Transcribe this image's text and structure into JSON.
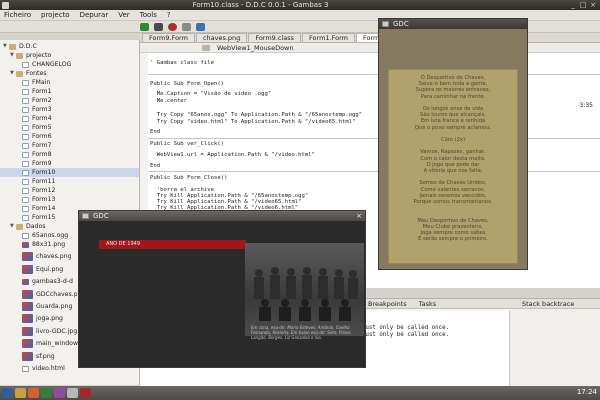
{
  "window": {
    "title": "Form10.class - D.D.C 0.0.1 - Gambas 3"
  },
  "menu": [
    "Ficheiro",
    "projecto",
    "Depurar",
    "Ver",
    "Tools",
    "?"
  ],
  "tree": [
    {
      "label": "D.D.C",
      "kind": "folder",
      "level": 0,
      "selected": false
    },
    {
      "label": "projecto",
      "kind": "folder",
      "level": 1,
      "selected": false
    },
    {
      "label": "CHANGELOG",
      "kind": "txt",
      "level": 2,
      "selected": false
    },
    {
      "label": "Fontes",
      "kind": "folder",
      "level": 1,
      "selected": false
    },
    {
      "label": "FMain",
      "kind": "form",
      "level": 2,
      "selected": false
    },
    {
      "label": "Form1",
      "kind": "form",
      "level": 2,
      "selected": false
    },
    {
      "label": "Form2",
      "kind": "form",
      "level": 2,
      "selected": false
    },
    {
      "label": "Form3",
      "kind": "form",
      "level": 2,
      "selected": false
    },
    {
      "label": "Form4",
      "kind": "form",
      "level": 2,
      "selected": false
    },
    {
      "label": "Form5",
      "kind": "form",
      "level": 2,
      "selected": false
    },
    {
      "label": "Form6",
      "kind": "form",
      "level": 2,
      "selected": false
    },
    {
      "label": "Form7",
      "kind": "form",
      "level": 2,
      "selected": false
    },
    {
      "label": "Form8",
      "kind": "form",
      "level": 2,
      "selected": false
    },
    {
      "label": "Form9",
      "kind": "form",
      "level": 2,
      "selected": false
    },
    {
      "label": "Form10",
      "kind": "form",
      "level": 2,
      "selected": true
    },
    {
      "label": "Form11",
      "kind": "form",
      "level": 2,
      "selected": false
    },
    {
      "label": "Form12",
      "kind": "form",
      "level": 2,
      "selected": false
    },
    {
      "label": "Form13",
      "kind": "form",
      "level": 2,
      "selected": false
    },
    {
      "label": "Form14",
      "kind": "form",
      "level": 2,
      "selected": false
    },
    {
      "label": "Form15",
      "kind": "form",
      "level": 2,
      "selected": false
    },
    {
      "label": "Dados",
      "kind": "folder",
      "level": 1,
      "selected": false
    },
    {
      "label": "65anos.ogg",
      "kind": "txt",
      "level": 2,
      "selected": false
    },
    {
      "label": "88x31.png",
      "kind": "img",
      "level": 2,
      "selected": false
    },
    {
      "label": "chaves.png",
      "kind": "img",
      "level": 2,
      "selected": false
    },
    {
      "label": "Equi.png",
      "kind": "img",
      "level": 2,
      "selected": false
    },
    {
      "label": "gambas3-d-d",
      "kind": "img",
      "level": 2,
      "selected": false
    },
    {
      "label": "GDCchaves.png",
      "kind": "img",
      "level": 2,
      "selected": false
    },
    {
      "label": "Guarda.png",
      "kind": "img",
      "level": 2,
      "selected": false
    },
    {
      "label": "joga.png",
      "kind": "img",
      "level": 2,
      "selected": false
    },
    {
      "label": "livro-GDC.jpg",
      "kind": "img",
      "level": 2,
      "selected": false
    },
    {
      "label": "main_window_table_thumb.jpg",
      "kind": "img",
      "level": 2,
      "selected": false
    },
    {
      "label": "sf.png",
      "kind": "img",
      "level": 2,
      "selected": false
    },
    {
      "label": "video.html",
      "kind": "txt",
      "level": 2,
      "selected": false
    }
  ],
  "tabs": [
    "Form9.Form",
    "chaves.png",
    "Form9.class",
    "Form1.Form",
    "Form11"
  ],
  "editor": {
    "method_combo": "WebView1_MouseDown",
    "position": "3:35"
  },
  "code_lines": [
    {
      "text": "' Gambas class file",
      "cls": "cm"
    },
    {
      "text": "Public Sub Form_Open()",
      "cls": "kw"
    },
    {
      "text": "  Me.Caption = \"Visão de video .ogg\"",
      "cls": "fn"
    },
    {
      "text": "  Me.center",
      "cls": "fn"
    },
    {
      "text": "  Try Copy \"65anos.ogg\" To Application.Path & \"/65anostemp.ogg\"",
      "cls": "fn"
    },
    {
      "text": "  Try Copy \"video.html\" To Application.Path & \"/video65.html\"",
      "cls": "fn"
    },
    {
      "text": "End",
      "cls": "kw"
    },
    {
      "text": "Public Sub ver_Click()",
      "cls": "kw"
    },
    {
      "text": "  WebView1.url = Application.Path & \"/video.html\"",
      "cls": "fn"
    },
    {
      "text": "End",
      "cls": "kw"
    },
    {
      "text": "Public Sub Form_Close()",
      "cls": "kw"
    },
    {
      "text": "  'borra el archive",
      "cls": "cm"
    },
    {
      "text": "  Try Kill Application.Path & \"/65anostemp.ogg\"",
      "cls": "fn"
    },
    {
      "text": "  Try Kill Application.Path & \"/video65.html\"",
      "cls": "fn"
    },
    {
      "text": "  Try Kill Application.Path & \"/video6.html\"",
      "cls": "fn"
    }
  ],
  "bottom": {
    "tabs": [
      "Breakpoints",
      "Tasks"
    ],
    "stack_title": "Stack backtrace",
    "console_lines": [
      "QNetworkReplyImplPrivate::error: Internal problem, this method must only be called once.",
      "QNetworkReplyImplPrivate::error: Internal problem, this method must only be called once."
    ]
  },
  "gdc1": {
    "title": "GDC",
    "lyrics": [
      "Ó Desportivo de Chaves,",
      "Salve-o bem toda a gente,",
      "Supera os maiores entraves,",
      "Para caminhar na frente.",
      "",
      "Os longos anos de vida",
      "São louros que alcançais,",
      "Em luta franca e renhida",
      "Que o povo sempre aclamou.",
      "",
      "Côro (2x)",
      "",
      "Vamos, Rapazes, ganhar,",
      "Com o calor desta malta,",
      "O jogo que pode dar",
      "A vitória que nos falta.",
      "",
      "Somos de Chaves Unidos,",
      "Como valentes serranos,",
      "Jamais seremos vencidos,",
      "Porque somos transmontanos.",
      "",
      "",
      "Meu Desportivo de Chaves,",
      "Meu Clube prazenteiro,",
      "Joga sempre como sabes",
      "E serás sempre o primeiro."
    ]
  },
  "gdc2": {
    "title": "GDC",
    "ribbon": "ANO DE 1949",
    "caption": "Em cima, esq-dir: Mario Esteves, António, Coelho Fernando, Rosinha. Em baixo esq-dir: Sato, Flávio Langão, Borges, Liz Gonzalez e Ivo."
  },
  "taskbar": {
    "clock": "17:24"
  },
  "colors": {
    "tree_selected": "#cad7ea",
    "ribbon": "#a0161a",
    "lyrics_bg": "#857a5f"
  }
}
